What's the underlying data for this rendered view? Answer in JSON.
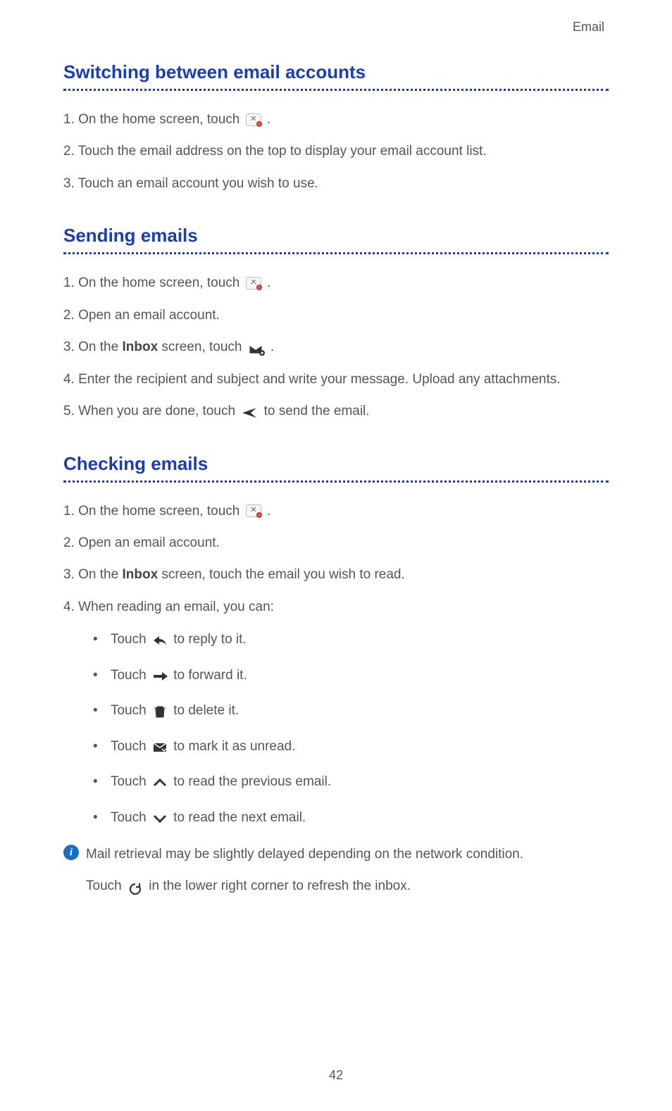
{
  "header": "Email",
  "pageNumber": "42",
  "sections": [
    {
      "title": "Switching between email accounts",
      "items": [
        {
          "num": "1.",
          "pre": "On the home screen, touch ",
          "icon": "email-app",
          "post": "."
        },
        {
          "num": "2.",
          "text": "Touch the email address on the top to display your email account list."
        },
        {
          "num": "3.",
          "text": "Touch an email account you wish to use."
        }
      ]
    },
    {
      "title": "Sending emails",
      "items": [
        {
          "num": "1.",
          "pre": "On the home screen, touch ",
          "icon": "email-app",
          "post": "."
        },
        {
          "num": "2.",
          "text": "Open an email account."
        },
        {
          "num": "3.",
          "pre": "On the ",
          "bold": "Inbox",
          "mid": " screen, touch ",
          "icon": "compose",
          "post": "."
        },
        {
          "num": "4.",
          "text": "Enter the recipient and subject and write your message. Upload any attachments."
        },
        {
          "num": "5.",
          "pre": "When you are done, touch ",
          "icon": "send",
          "post": " to send the email."
        }
      ]
    },
    {
      "title": "Checking emails",
      "items": [
        {
          "num": "1.",
          "pre": "On the home screen, touch ",
          "icon": "email-app",
          "post": "."
        },
        {
          "num": "2.",
          "text": "Open an email account."
        },
        {
          "num": "3.",
          "pre": "On the ",
          "bold": "Inbox",
          "mid": " screen, touch the email you wish to read."
        },
        {
          "num": "4.",
          "text": "When reading an email, you can:",
          "sub": [
            {
              "pre": "Touch ",
              "icon": "reply",
              "post": " to reply to it."
            },
            {
              "pre": "Touch ",
              "icon": "forward",
              "post": "to forward it."
            },
            {
              "pre": "Touch ",
              "icon": "trash",
              "post": " to delete it."
            },
            {
              "pre": "Touch ",
              "icon": "unread",
              "post": " to mark it as unread."
            },
            {
              "pre": "Touch ",
              "icon": "prev",
              "post": " to read the previous email."
            },
            {
              "pre": "Touch ",
              "icon": "next",
              "post": " to read the next email."
            }
          ]
        }
      ],
      "note": {
        "line1": "Mail retrieval may be slightly delayed depending on the network condition.",
        "line2pre": "Touch ",
        "line2icon": "refresh",
        "line2post": " in the lower right corner to refresh the inbox."
      }
    }
  ]
}
